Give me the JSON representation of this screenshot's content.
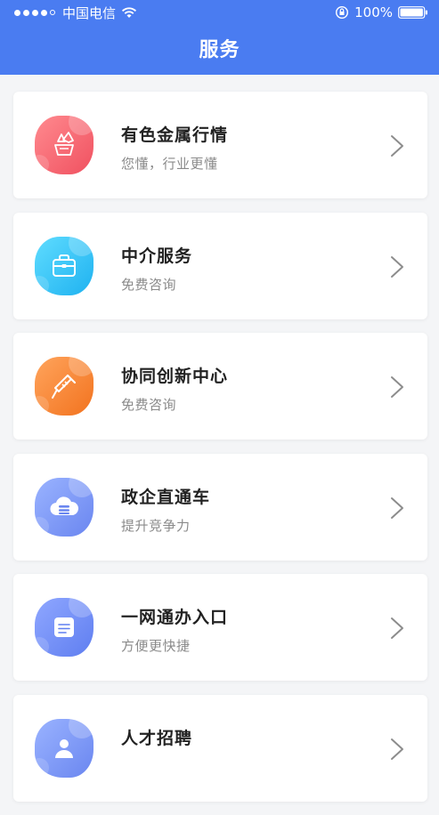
{
  "status_bar": {
    "carrier": "中国电信",
    "battery": "100%"
  },
  "header": {
    "title": "服务"
  },
  "services": [
    {
      "title": "有色金属行情",
      "subtitle": "您懂，行业更懂",
      "icon": "crystal-icon",
      "color": "#f05160"
    },
    {
      "title": "中介服务",
      "subtitle": "免费咨询",
      "icon": "briefcase-icon",
      "color": "#1fb2f0"
    },
    {
      "title": "协同创新中心",
      "subtitle": "免费咨询",
      "icon": "syringe-icon",
      "color": "#f2731f"
    },
    {
      "title": "政企直通车",
      "subtitle": "提升竞争力",
      "icon": "cloud-server-icon",
      "color": "#6a86f0"
    },
    {
      "title": "一网通办入口",
      "subtitle": "方便更快捷",
      "icon": "document-icon",
      "color": "#5f7ef0"
    },
    {
      "title": "人才招聘",
      "subtitle": "",
      "icon": "people-icon",
      "color": "#6a86f0"
    }
  ]
}
